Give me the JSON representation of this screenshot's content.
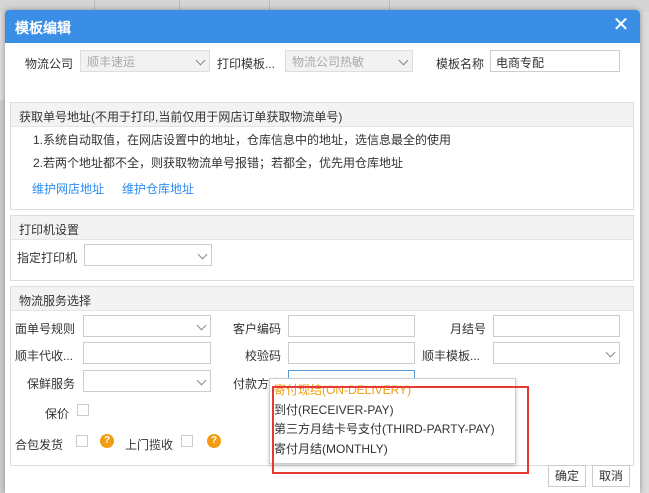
{
  "dialog": {
    "title": "模板编辑",
    "close_symbol": "✕"
  },
  "header_row": {
    "logistics_label": "物流公司",
    "logistics_value": "顺丰速运",
    "print_template_label": "打印模板...",
    "print_template_value": "物流公司热敏",
    "template_name_label": "模板名称",
    "template_name_value": "电商专配"
  },
  "tracking_panel": {
    "title": "获取单号地址(不用于打印,当前仅用于网店订单获取物流单号)",
    "line1": "1.系统自动取值，在网店设置中的地址，仓库信息中的地址，选信息最全的使用",
    "line2": "2.若两个地址都不全，则获取物流单号报错；若都全，优先用仓库地址",
    "link_store": "维护网店地址",
    "link_warehouse": "维护仓库地址"
  },
  "printer_panel": {
    "title": "打印机设置",
    "printer_label": "指定打印机",
    "printer_value": ""
  },
  "service_panel": {
    "title": "物流服务选择",
    "face_rule_label": "面单号规则",
    "customer_code_label": "客户编码",
    "monthly_no_label": "月结号",
    "cod_label": "顺丰代收...",
    "checkcode_label": "校验码",
    "sf_template_label": "顺丰模板...",
    "fresh_label": "保鲜服务",
    "payment_label": "付款方式",
    "insured_label": "保价",
    "merge_label": "合包发货",
    "pickup_label": "上门揽收"
  },
  "payment_dropdown": {
    "options": [
      "寄付现结(ON-DELIVERY)",
      "到付(RECEIVER-PAY)",
      "第三方月结卡号支付(THIRD-PARTY-PAY)",
      "寄付月结(MONTHLY)"
    ],
    "highlighted_index": 0
  },
  "footer": {
    "ok_label": "确定",
    "cancel_label": "取消"
  },
  "colors": {
    "title_bar": "#3a8ee6",
    "link": "#2d8cf0",
    "highlight": "#f39c12",
    "annotation_box": "#e53935"
  },
  "icons": {
    "help": "help-icon",
    "dropdown": "chevron-down-icon",
    "close": "close-icon"
  }
}
